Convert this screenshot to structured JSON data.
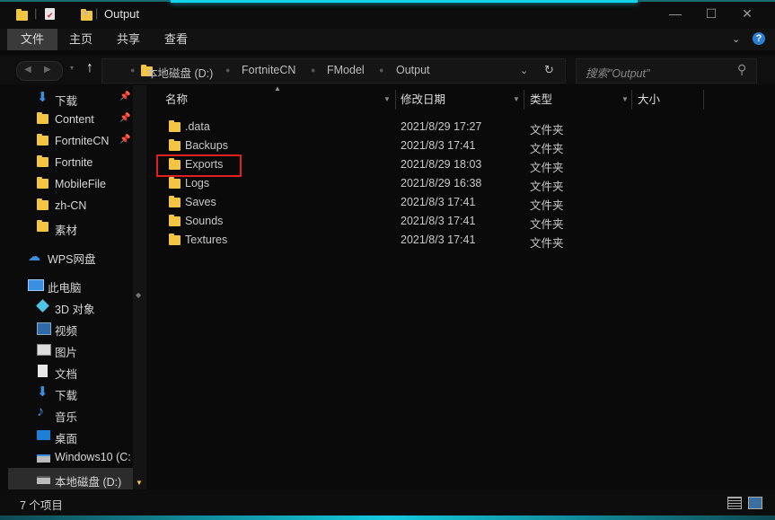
{
  "window": {
    "title": "Output",
    "minimize": "—",
    "maximize": "☐",
    "close": "✕"
  },
  "ribbon": {
    "tabs": [
      "文件",
      "主页",
      "共享",
      "查看"
    ],
    "help": "?"
  },
  "address": {
    "crumbs": [
      "本地磁盘 (D:)",
      "FortniteCN",
      "FModel",
      "Output"
    ],
    "search_placeholder": "搜索\"Output\""
  },
  "nav": {
    "quick": [
      {
        "label": "下载",
        "icon": "download-arrow-icon",
        "pinned": true
      },
      {
        "label": "Content",
        "icon": "folder-icon",
        "pinned": true
      },
      {
        "label": "FortniteCN",
        "icon": "folder-icon",
        "pinned": true
      },
      {
        "label": "Fortnite",
        "icon": "folder-icon",
        "pinned": false
      },
      {
        "label": "MobileFile",
        "icon": "folder-icon",
        "pinned": false
      },
      {
        "label": "zh-CN",
        "icon": "folder-icon",
        "pinned": false
      },
      {
        "label": "素材",
        "icon": "folder-icon",
        "pinned": false
      }
    ],
    "wps": "WPS网盘",
    "thispc": "此电脑",
    "pc_items": [
      {
        "label": "3D 对象",
        "icon": "3d-objects-icon"
      },
      {
        "label": "视频",
        "icon": "video-icon"
      },
      {
        "label": "图片",
        "icon": "pictures-icon"
      },
      {
        "label": "文档",
        "icon": "documents-icon"
      },
      {
        "label": "下载",
        "icon": "download-arrow-icon"
      },
      {
        "label": "音乐",
        "icon": "music-icon"
      },
      {
        "label": "桌面",
        "icon": "desktop-icon"
      },
      {
        "label": "Windows10 (C:",
        "icon": "drive-icon"
      },
      {
        "label": "本地磁盘 (D:)",
        "icon": "drive-icon"
      }
    ]
  },
  "columns": {
    "name": "名称",
    "date": "修改日期",
    "type": "类型",
    "size": "大小"
  },
  "files": [
    {
      "name": ".data",
      "date": "2021/8/29 17:27",
      "type": "文件夹"
    },
    {
      "name": "Backups",
      "date": "2021/8/3 17:41",
      "type": "文件夹"
    },
    {
      "name": "Exports",
      "date": "2021/8/29 18:03",
      "type": "文件夹"
    },
    {
      "name": "Logs",
      "date": "2021/8/29 16:38",
      "type": "文件夹"
    },
    {
      "name": "Saves",
      "date": "2021/8/3 17:41",
      "type": "文件夹"
    },
    {
      "name": "Sounds",
      "date": "2021/8/3 17:41",
      "type": "文件夹"
    },
    {
      "name": "Textures",
      "date": "2021/8/3 17:41",
      "type": "文件夹"
    }
  ],
  "status": {
    "count": "7 个项目"
  },
  "colors": {
    "accent": "#15d3e8",
    "folder": "#f4c542",
    "highlight": "#e02020"
  }
}
